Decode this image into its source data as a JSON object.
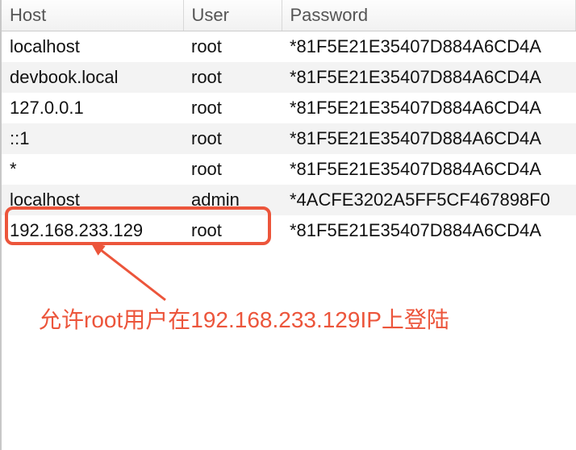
{
  "columns": {
    "host": "Host",
    "user": "User",
    "password": "Password"
  },
  "rows": [
    {
      "host": "localhost",
      "user": "root",
      "password": "*81F5E21E35407D884A6CD4A"
    },
    {
      "host": "devbook.local",
      "user": "root",
      "password": "*81F5E21E35407D884A6CD4A"
    },
    {
      "host": "127.0.0.1",
      "user": "root",
      "password": "*81F5E21E35407D884A6CD4A"
    },
    {
      "host": "::1",
      "user": "root",
      "password": "*81F5E21E35407D884A6CD4A"
    },
    {
      "host": "*",
      "user": "root",
      "password": "*81F5E21E35407D884A6CD4A"
    },
    {
      "host": "localhost",
      "user": "admin",
      "password": "*4ACFE3202A5FF5CF467898F0"
    },
    {
      "host": "192.168.233.129",
      "user": "root",
      "password": "*81F5E21E35407D884A6CD4A"
    }
  ],
  "annotation": "允许root用户在192.168.233.129IP上登陆",
  "highlight_color": "#ec553b"
}
